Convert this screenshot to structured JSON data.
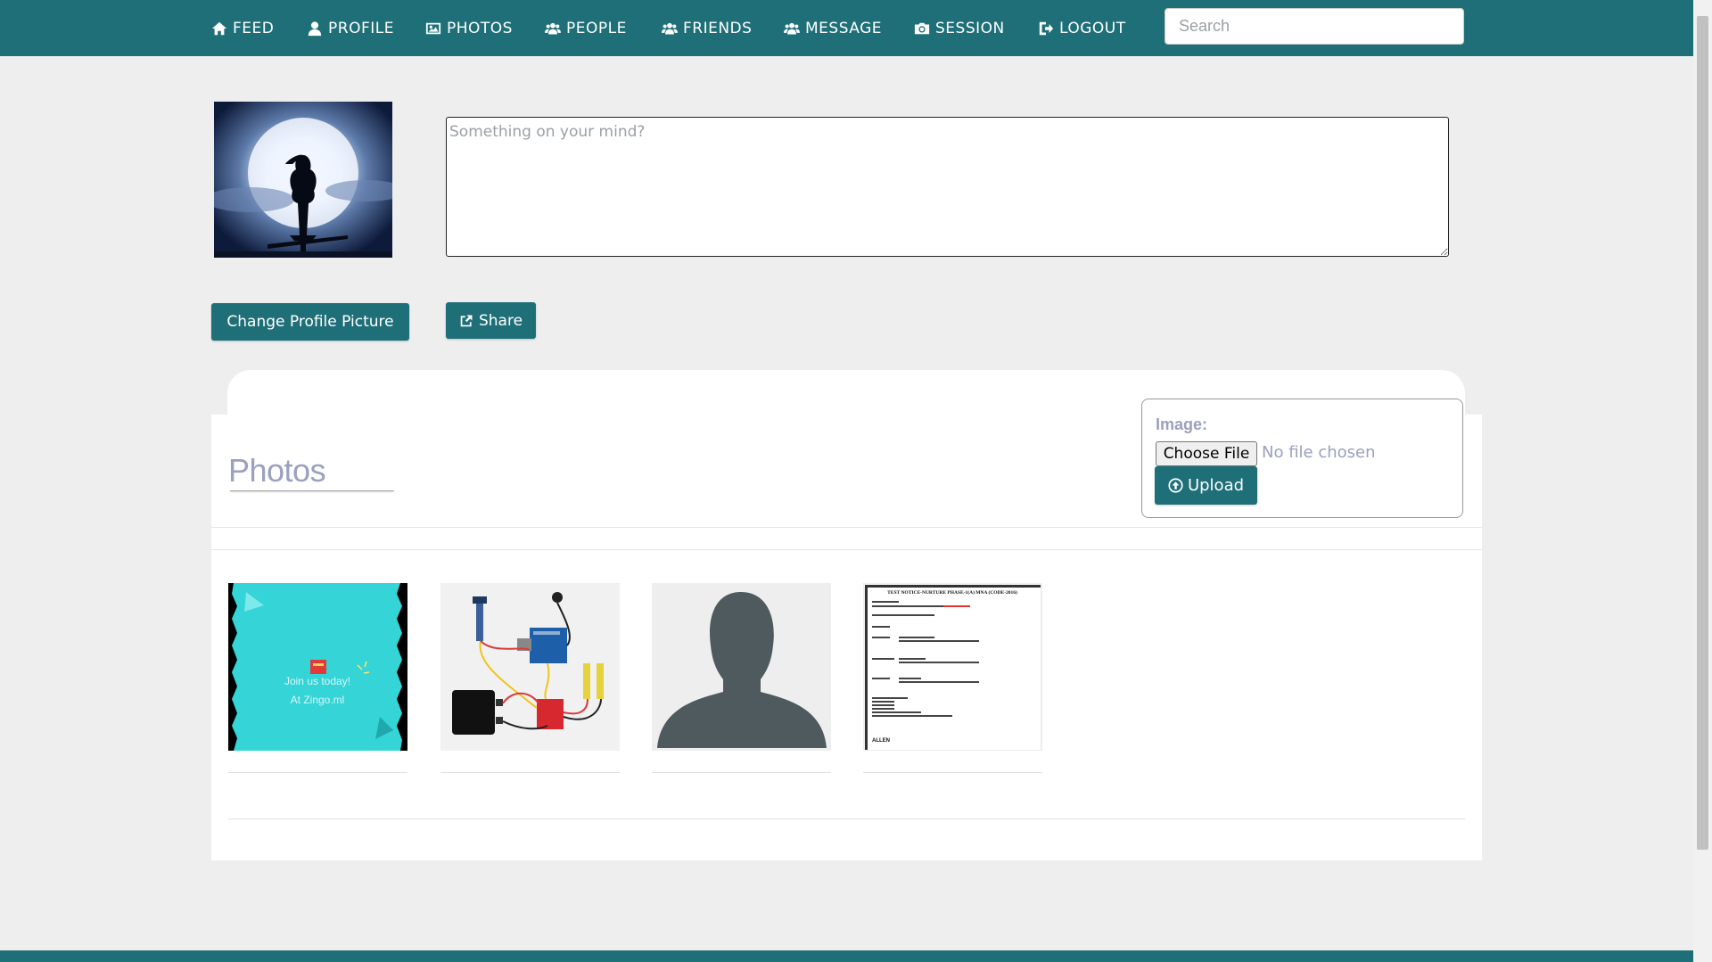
{
  "nav": {
    "items": [
      {
        "label": "FEED",
        "icon": "home-icon"
      },
      {
        "label": "PROFILE",
        "icon": "user-icon"
      },
      {
        "label": "PHOTOS",
        "icon": "image-icon"
      },
      {
        "label": "PEOPLE",
        "icon": "users-icon"
      },
      {
        "label": "FRIENDS",
        "icon": "users-icon"
      },
      {
        "label": "MESSAGE",
        "icon": "users-icon"
      },
      {
        "label": "SESSION",
        "icon": "camera-icon"
      },
      {
        "label": "LOGOUT",
        "icon": "sign-out-icon"
      }
    ],
    "search_placeholder": "Search"
  },
  "composer": {
    "placeholder": "Something on your mind?",
    "change_picture_label": "Change Profile Picture",
    "share_label": "Share"
  },
  "photos": {
    "title": "Photos",
    "upload": {
      "label": "Image:",
      "choose_file_label": "Choose File",
      "no_file_text": "No file chosen",
      "upload_label": "Upload"
    },
    "items": [
      {
        "caption_line1": "Join us today!",
        "caption_line2": "At Zingo.ml"
      },
      {
        "caption_line1": ""
      },
      {
        "caption_line1": ""
      },
      {
        "caption_line1": "TEST NOTICE-NURTURE PHASE-1(A) MNA (CODE-2016)",
        "footer": "ALLEN"
      }
    ]
  },
  "colors": {
    "primary": "#1f6f78",
    "background": "#eeeeee",
    "muted_text": "#9aa0bf"
  }
}
